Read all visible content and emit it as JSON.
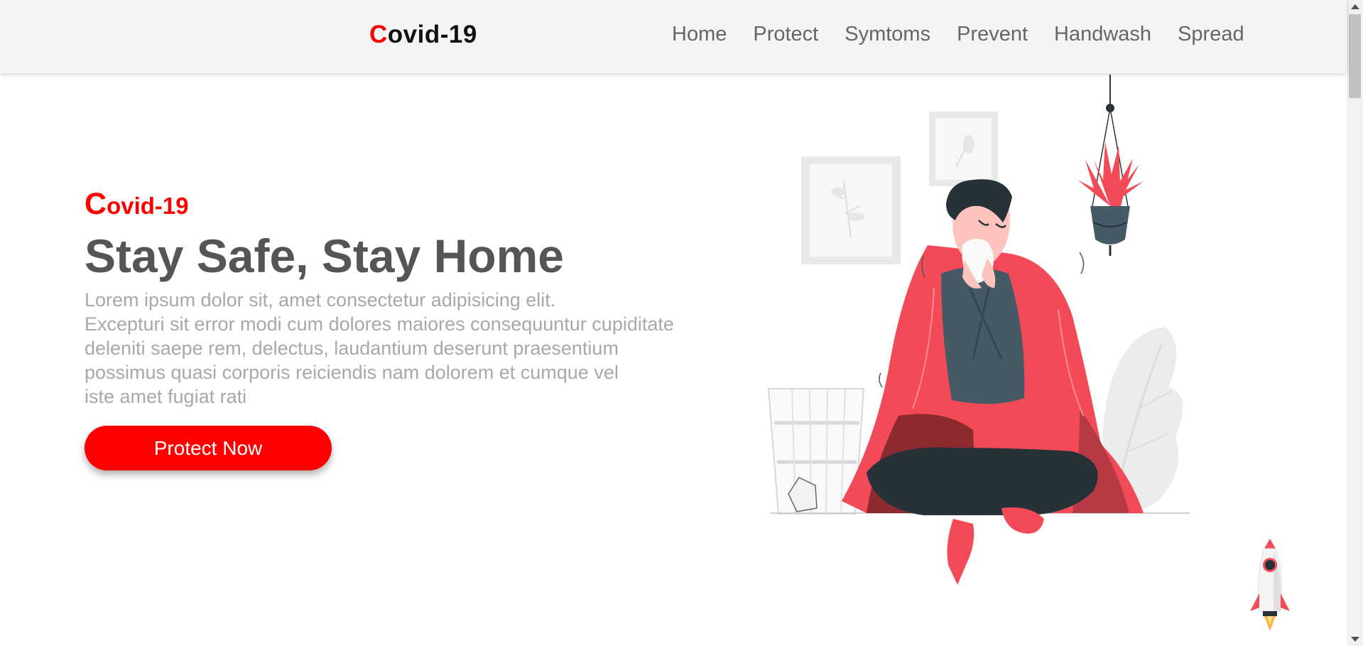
{
  "navbar": {
    "brand_first": "C",
    "brand_rest": "ovid-19",
    "links": [
      "Home",
      "Protect",
      "Symtoms",
      "Prevent",
      "Handwash",
      "Spread"
    ]
  },
  "hero": {
    "brand_first": "C",
    "brand_rest": "ovid-19",
    "title": "Stay Safe, Stay Home",
    "paragraph_lines": [
      "Lorem ipsum dolor sit, amet consectetur adipisicing elit.",
      "Excepturi sit error modi cum dolores maiores consequuntur cupiditate",
      "deleniti saepe rem, delectus, laudantium deserunt praesentium",
      "possimus quasi corporis reiciendis nam dolorem et cumque vel",
      "iste amet fugiat rati"
    ],
    "cta_label": "Protect Now"
  },
  "illustration": {
    "icon": "sick-person-illustration"
  },
  "scroll_to_top": {
    "icon": "rocket-icon"
  },
  "colors": {
    "accent": "#ff0000",
    "navbar_bg": "#f4f4f4",
    "title": "#555555",
    "body_text": "#a8a8a8",
    "nav_text": "#666666",
    "blanket": "#f24b57",
    "clothes": "#3d4a55"
  }
}
